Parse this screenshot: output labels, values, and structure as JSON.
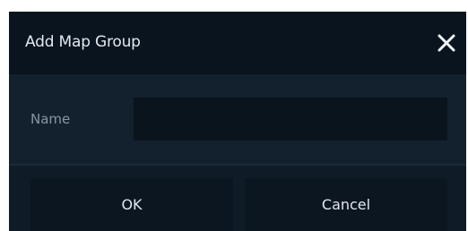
{
  "dialog": {
    "title": "Add Map Group",
    "close_icon": "close-icon"
  },
  "form": {
    "name_label": "Name",
    "name_value": "",
    "name_placeholder": ""
  },
  "buttons": {
    "ok_label": "OK",
    "cancel_label": "Cancel"
  },
  "colors": {
    "titlebar_bg": "#0a141e",
    "body_bg": "#13212e",
    "input_bg": "#0a141d",
    "button_bg": "#0b1621",
    "text": "#e3e8ee",
    "label_text": "#8796a6"
  }
}
